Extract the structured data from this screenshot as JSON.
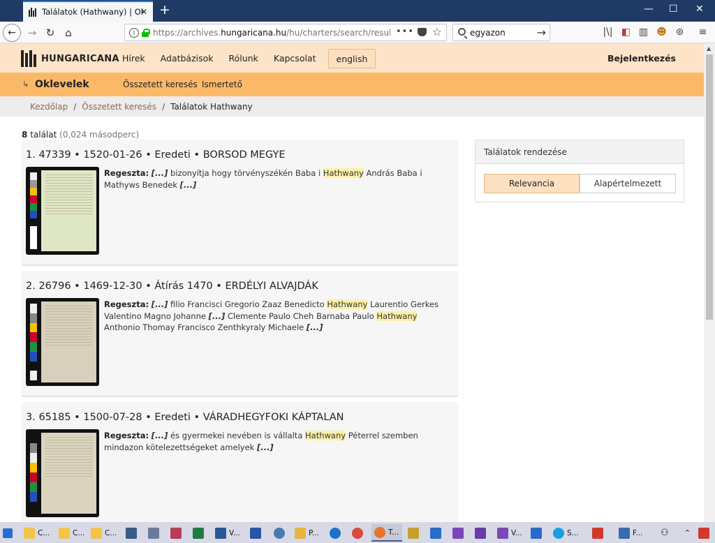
{
  "browser": {
    "tab_title": "Találatok (Hathwany) | Oklevelek",
    "new_tab": "+",
    "minimize": "—",
    "maximize": "☐",
    "close": "✕",
    "url_prefix": "https://archives.",
    "url_domain": "hungaricana.hu",
    "url_suffix": "/hu/charters/search/results/?list",
    "search_value": "egyazon",
    "page_actions": "•••"
  },
  "site": {
    "logo_text": "HUNGARICANA",
    "nav": [
      "Hírek",
      "Adatbázisok",
      "Rólunk",
      "Kapcsolat"
    ],
    "lang": "english",
    "login": "Bejelentkezés",
    "section_title": "Oklevelek",
    "section_nav": [
      "Összetett keresés",
      "Ismertető"
    ],
    "breadcrumb": {
      "home": "Kezdőlap",
      "sep": "/",
      "advanced": "Összetett keresés",
      "current": "Találatok Hathwany"
    }
  },
  "results": {
    "count": "8",
    "count_label": "találat",
    "time": "(0,024 másodperc)",
    "regeszta_label": "Regeszta:",
    "ellipsis": "[...]",
    "items": [
      {
        "title": "1. 47339 • 1520-01-26 • Eredeti • BORSOD MEGYE",
        "t1": "bizonyítja hogy törvényszékén Baba i",
        "h1": "Hathwany",
        "t2": "András Baba i Mathyws Benedek"
      },
      {
        "title": "2. 26796 • 1469-12-30 • Átírás 1470 • ERDÉLYI ALVAJDÁK",
        "t1": "filio Francisci Gregorio Zaaz Benedicto",
        "h1": "Hathwany",
        "t2": "Laurentio Gerkes Valentino Magno Johanne",
        "t3": "Clemente Paulo Cheh Barnaba Paulo",
        "h2": "Hathwany",
        "t4": "Anthonio Thomay Francisco Zenthkyraly Michaele"
      },
      {
        "title": "3. 65185 • 1500-07-28 • Eredeti • VÁRADHEGYFOKI KÁPTALAN",
        "t1": "és gyermekei nevében is vállalta",
        "h1": "Hathwany",
        "t2": "Péterrel szemben mindazon kötelezettségeket amelyek"
      }
    ]
  },
  "sort": {
    "title": "Találatok rendezése",
    "relevance": "Relevancia",
    "default": "Alapértelmezett"
  },
  "taskbar": {
    "items": [
      "C...",
      "C...",
      "C...",
      "V...",
      "P...",
      "T...",
      "V...",
      "S...",
      "F..."
    ]
  },
  "colors": {
    "header_bg": "#fde4c8",
    "subheader_bg": "#fbb968",
    "highlight": "#fbf1a7",
    "tabbar": "#1f3a64"
  }
}
